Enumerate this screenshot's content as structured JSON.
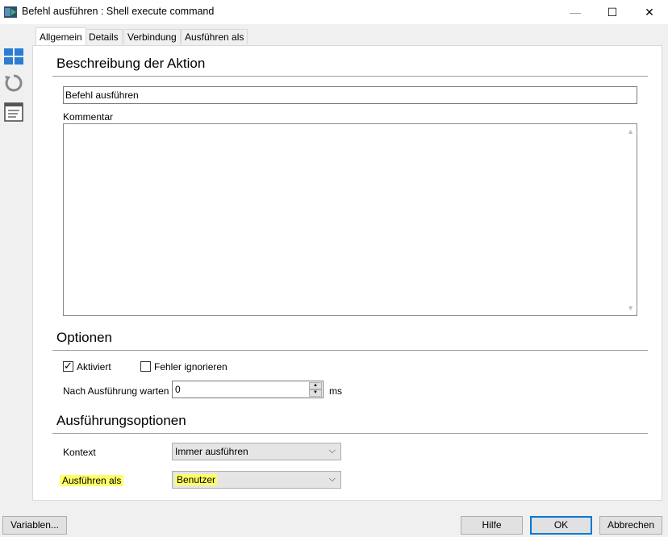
{
  "window": {
    "title": "Befehl ausführen : Shell execute command",
    "minimize_label": "—",
    "maximize_label": "☐",
    "close_label": "✕"
  },
  "sidebar": {
    "icons": [
      "layout-icon",
      "refresh-icon",
      "notes-icon"
    ]
  },
  "tabs": [
    {
      "label": "Allgemein",
      "active": true
    },
    {
      "label": "Details",
      "active": false
    },
    {
      "label": "Verbindung",
      "active": false
    },
    {
      "label": "Ausführen als",
      "active": false
    }
  ],
  "description": {
    "heading": "Beschreibung der Aktion",
    "name_value": "Befehl ausführen",
    "comment_label": "Kommentar",
    "comment_value": ""
  },
  "options": {
    "heading": "Optionen",
    "enabled_label": "Aktiviert",
    "enabled_checked": true,
    "ignore_errors_label": "Fehler ignorieren",
    "ignore_errors_checked": false,
    "wait_label": "Nach Ausführung warten",
    "wait_value": "0",
    "wait_unit": "ms"
  },
  "execution": {
    "heading": "Ausführungsoptionen",
    "context_label": "Kontext",
    "context_value": "Immer ausführen",
    "run_as_label": "Ausführen als",
    "run_as_value": "Benutzer",
    "highlight_color": "#ffff66"
  },
  "footer": {
    "variables_label": "Variablen...",
    "help_label": "Hilfe",
    "ok_label": "OK",
    "cancel_label": "Abbrechen"
  }
}
